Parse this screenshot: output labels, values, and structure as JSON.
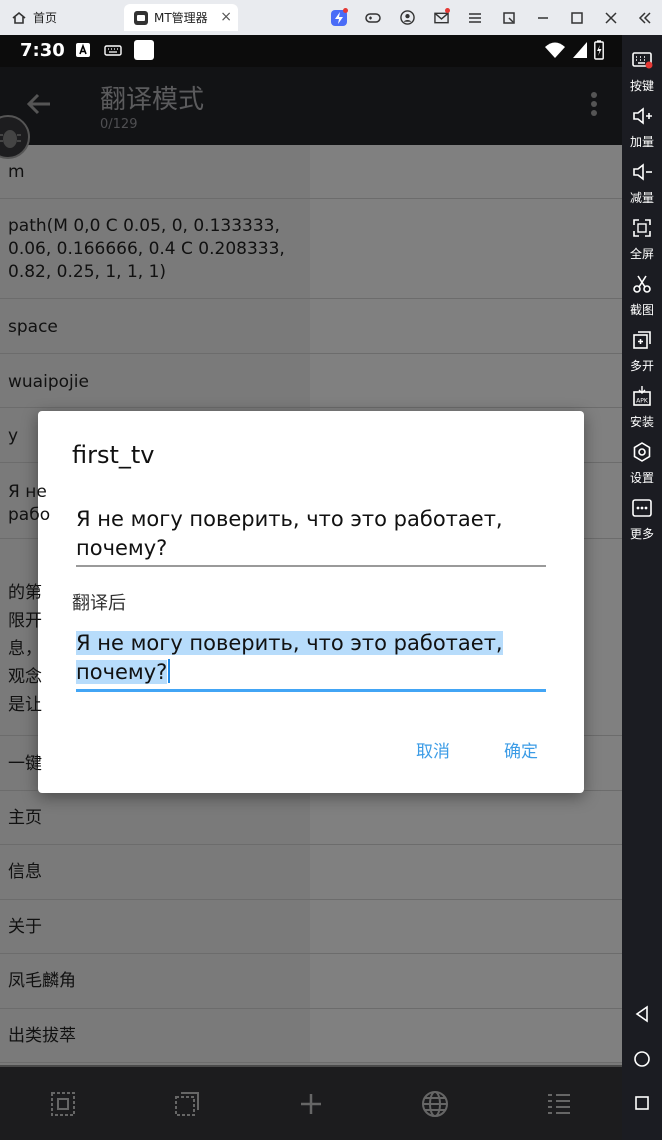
{
  "emulator": {
    "home_tab": "首页",
    "active_tab": "MT管理器",
    "tab_close": "×",
    "sidebar": [
      {
        "label": "按键",
        "icon": "keyboard-icon"
      },
      {
        "label": "加量",
        "icon": "volume-up-icon"
      },
      {
        "label": "减量",
        "icon": "volume-down-icon"
      },
      {
        "label": "全屏",
        "icon": "fullscreen-icon"
      },
      {
        "label": "截图",
        "icon": "scissors-icon"
      },
      {
        "label": "多开",
        "icon": "multi-instance-icon"
      },
      {
        "label": "安装",
        "icon": "apk-install-icon"
      },
      {
        "label": "设置",
        "icon": "gear-icon"
      },
      {
        "label": "更多",
        "icon": "more-icon"
      }
    ]
  },
  "status": {
    "time": "7:30"
  },
  "appbar": {
    "title": "翻译模式",
    "subtitle": "0/129"
  },
  "list": {
    "rows": [
      {
        "text": "m"
      },
      {
        "text": "path(M 0,0 C 0.05, 0, 0.133333,\n0.06, 0.166666, 0.4 C 0.208333,\n0.82, 0.25, 1, 1, 1)"
      },
      {
        "text": "space"
      },
      {
        "text": "wuaipojie"
      },
      {
        "text": "y"
      },
      {
        "text": "Я не\nрабо"
      },
      {
        "text": "\n的第\n限开\n息，\n观念\n是让"
      },
      {
        "text": "一键"
      },
      {
        "text": "主页"
      },
      {
        "text": "信息"
      },
      {
        "text": "关于"
      },
      {
        "text": "凤毛麟角"
      },
      {
        "text": "出类拔萃"
      }
    ]
  },
  "dialog": {
    "title": "first_tv",
    "original": "Я не могу поверить, что это работает, почему?",
    "translated_label": "翻译后",
    "translated": "Я не могу поверить, что это работает, почему?",
    "cancel": "取消",
    "ok": "确定"
  },
  "colors": {
    "accent": "#3c9ce6",
    "selection": "#b7dcfb",
    "underline_active": "#42a5f5"
  }
}
